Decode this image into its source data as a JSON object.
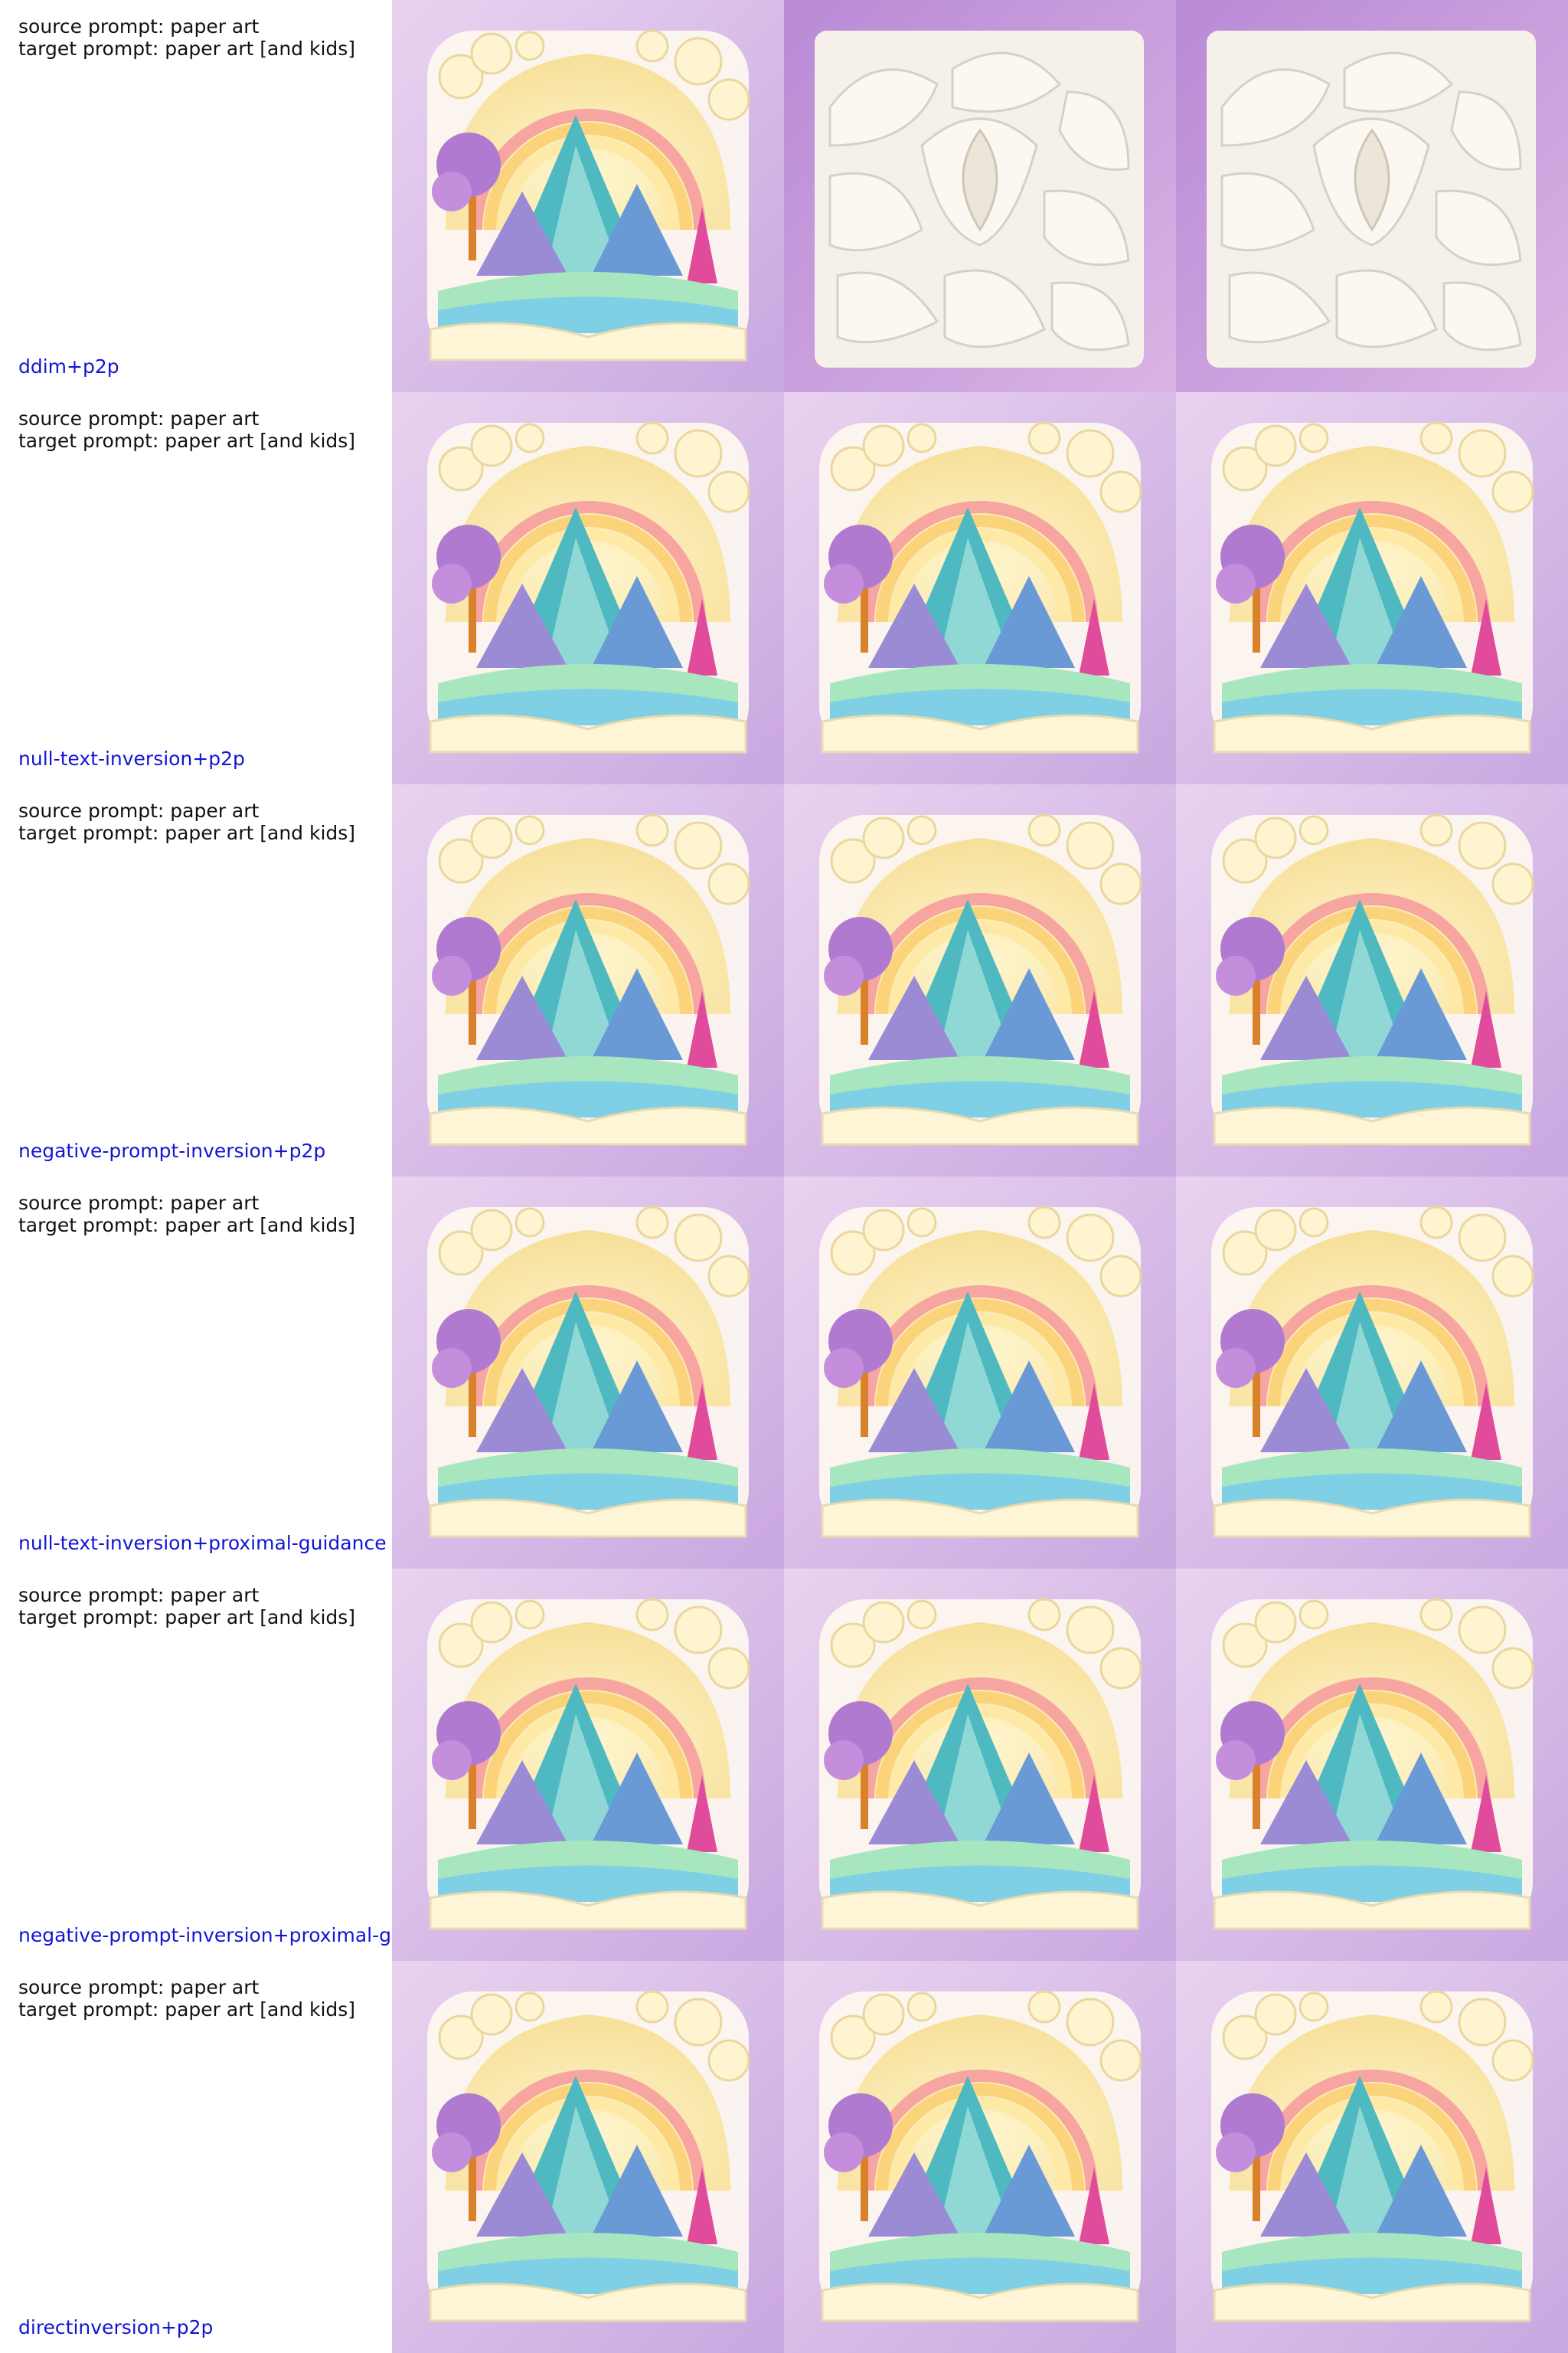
{
  "rows": [
    {
      "source": "source prompt: paper art",
      "target": "target prompt: paper art [and kids]",
      "method": "ddim+p2p"
    },
    {
      "source": "source prompt: paper art",
      "target": "target prompt: paper art [and kids]",
      "method": "null-text-inversion+p2p"
    },
    {
      "source": "source prompt: paper art",
      "target": "target prompt: paper art [and kids]",
      "method": "negative-prompt-inversion+p2p"
    },
    {
      "source": "source prompt: paper art",
      "target": "target prompt: paper art [and kids]",
      "method": "null-text-inversion+proximal-guidance"
    },
    {
      "source": "source prompt: paper art",
      "target": "target prompt: paper art [and kids]",
      "method": "negative-prompt-inversion+proximal-g"
    },
    {
      "source": "source prompt: paper art",
      "target": "target prompt: paper art [and kids]",
      "method": "directinversion+p2p"
    }
  ],
  "images": {
    "landscape": "paper-quilled rainbow landscape with mountains, trees and clouds",
    "white_relief": "white paper relief of layered petal shapes"
  },
  "colors": {
    "background_lavender": "#d9c2ea",
    "method_label": "#1414d6"
  }
}
